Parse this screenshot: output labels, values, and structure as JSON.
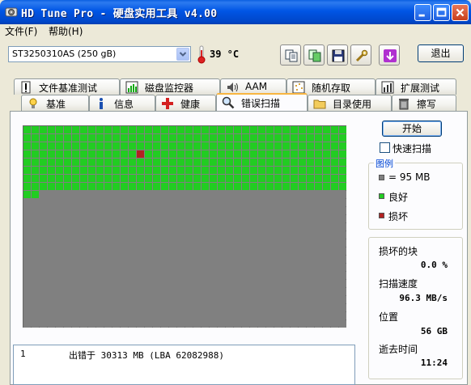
{
  "window": {
    "title": "HD Tune Pro - 硬盘实用工具 v4.00"
  },
  "menu": {
    "file": "文件(F)",
    "help": "帮助(H)"
  },
  "toolbar": {
    "drive": "ST3250310AS (250 gB)",
    "temperature": "39 °C",
    "exit_label": "退出"
  },
  "tabs": {
    "row1": [
      {
        "label": "文件基准测试",
        "icon": "file-benchmark-icon"
      },
      {
        "label": "磁盘监控器",
        "icon": "disk-monitor-icon"
      },
      {
        "label": "AAM",
        "icon": "speaker-icon"
      },
      {
        "label": "随机存取",
        "icon": "random-access-icon"
      },
      {
        "label": "扩展测试",
        "icon": "extra-tests-icon"
      }
    ],
    "row2": [
      {
        "label": "基准",
        "icon": "benchmark-icon"
      },
      {
        "label": "信息",
        "icon": "info-icon"
      },
      {
        "label": "健康",
        "icon": "health-icon"
      },
      {
        "label": "错误扫描",
        "icon": "magnifier-icon"
      },
      {
        "label": "目录使用",
        "icon": "folder-icon"
      },
      {
        "label": "擦写",
        "icon": "erase-icon"
      }
    ],
    "active": "错误扫描"
  },
  "scan": {
    "start_label": "开始",
    "quick_scan_label": "快速扫描",
    "quick_scan_checked": false,
    "grid": {
      "columns": 40,
      "rows": 25,
      "scanned_blocks": 322,
      "damaged_blocks": [
        {
          "row": 3,
          "col": 14
        }
      ]
    }
  },
  "legend": {
    "title": "图例",
    "block_size": "= 95 MB",
    "good": "良好",
    "damaged": "损坏",
    "colors": {
      "unscanned": "#808080",
      "good": "#22cc22",
      "damaged": "#b22222"
    }
  },
  "stats": {
    "damaged_blocks_label": "损坏的块",
    "damaged_blocks_value": "0.0 %",
    "scan_speed_label": "扫描速度",
    "scan_speed_value": "96.3 MB/s",
    "position_label": "位置",
    "position_value": "56 GB",
    "elapsed_label": "逝去时间",
    "elapsed_value": "11:24"
  },
  "log": [
    {
      "index": "1",
      "message": "出错于 30313 MB (LBA 62082988)"
    }
  ]
}
